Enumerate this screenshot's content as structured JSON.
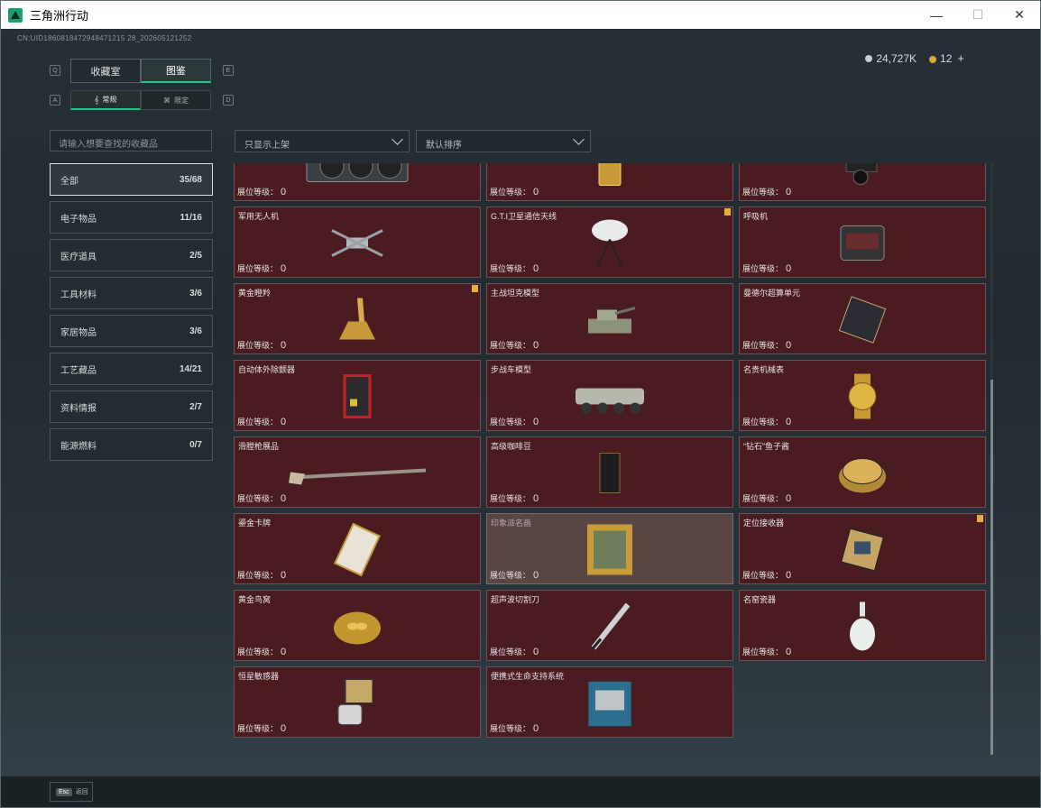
{
  "window": {
    "title": "三角洲行动",
    "minimize": "—",
    "maximize": "☐",
    "close": "✕"
  },
  "uid": "CN:UID1860818472948471215 28_202605121252",
  "currency": {
    "silver": "24,727K",
    "gold": "12",
    "plus": "+"
  },
  "keys": {
    "q": "Q",
    "e": "E",
    "a": "A",
    "d": "D"
  },
  "tabs": [
    "收藏室",
    "图鉴"
  ],
  "subtabs": [
    "常规",
    "限定"
  ],
  "search": {
    "placeholder": "请输入想要查找的收藏品"
  },
  "filters": {
    "shelf": "只显示上架",
    "sort": "默认排序"
  },
  "categories": [
    {
      "name": "全部",
      "count": "35/68"
    },
    {
      "name": "电子物品",
      "count": "11/16"
    },
    {
      "name": "医疗道具",
      "count": "2/5"
    },
    {
      "name": "工具材料",
      "count": "3/6"
    },
    {
      "name": "家居物品",
      "count": "3/6"
    },
    {
      "name": "工艺藏品",
      "count": "14/21"
    },
    {
      "name": "资料情报",
      "count": "2/7"
    },
    {
      "name": "能源燃料",
      "count": "0/7"
    }
  ],
  "level_label": "展位等级：",
  "items": [
    {
      "name": "",
      "level": "0",
      "icon": "graphics-card-icon"
    },
    {
      "name": "",
      "level": "0",
      "icon": "gold-bar-icon"
    },
    {
      "name": "",
      "level": "0",
      "icon": "camera-gimbal-icon"
    },
    {
      "name": "军用无人机",
      "level": "0",
      "icon": "drone-icon"
    },
    {
      "name": "G.T.I卫星通信天线",
      "level": "0",
      "icon": "satellite-dish-icon",
      "badge": true
    },
    {
      "name": "呼吸机",
      "level": "0",
      "icon": "ventilator-icon"
    },
    {
      "name": "黄金瞪羚",
      "level": "0",
      "icon": "golden-gazelle-icon",
      "badge": true
    },
    {
      "name": "主战坦克模型",
      "level": "0",
      "icon": "tank-model-icon"
    },
    {
      "name": "曼德尔超算单元",
      "level": "0",
      "icon": "supercomputer-unit-icon"
    },
    {
      "name": "自动体外除颤器",
      "level": "0",
      "icon": "defibrillator-icon"
    },
    {
      "name": "步战车模型",
      "level": "0",
      "icon": "ifv-model-icon"
    },
    {
      "name": "名贵机械表",
      "level": "0",
      "icon": "watch-icon"
    },
    {
      "name": "滑膛枪展品",
      "level": "0",
      "icon": "musket-icon"
    },
    {
      "name": "高级咖啡豆",
      "level": "0",
      "icon": "coffee-beans-icon"
    },
    {
      "name": "“钻石”鱼子酱",
      "level": "0",
      "icon": "caviar-tin-icon"
    },
    {
      "name": "鎏金卡牌",
      "level": "0",
      "icon": "gilded-card-icon"
    },
    {
      "name": "印象派名画",
      "level": "0",
      "icon": "painting-icon",
      "dim": true
    },
    {
      "name": "定位接收器",
      "level": "0",
      "icon": "locator-receiver-icon",
      "badge": true
    },
    {
      "name": "黄金鸟窝",
      "level": "0",
      "icon": "golden-nest-icon"
    },
    {
      "name": "超声波切割刀",
      "level": "0",
      "icon": "ultrasonic-cutter-icon"
    },
    {
      "name": "名窑瓷器",
      "level": "0",
      "icon": "porcelain-vase-icon"
    },
    {
      "name": "恒星敏感器",
      "level": "0",
      "icon": "star-sensor-icon"
    },
    {
      "name": "便携式生命支持系统",
      "level": "0",
      "icon": "life-support-icon"
    }
  ],
  "bottom": {
    "esc_key": "Esc",
    "esc_label": "返回"
  }
}
